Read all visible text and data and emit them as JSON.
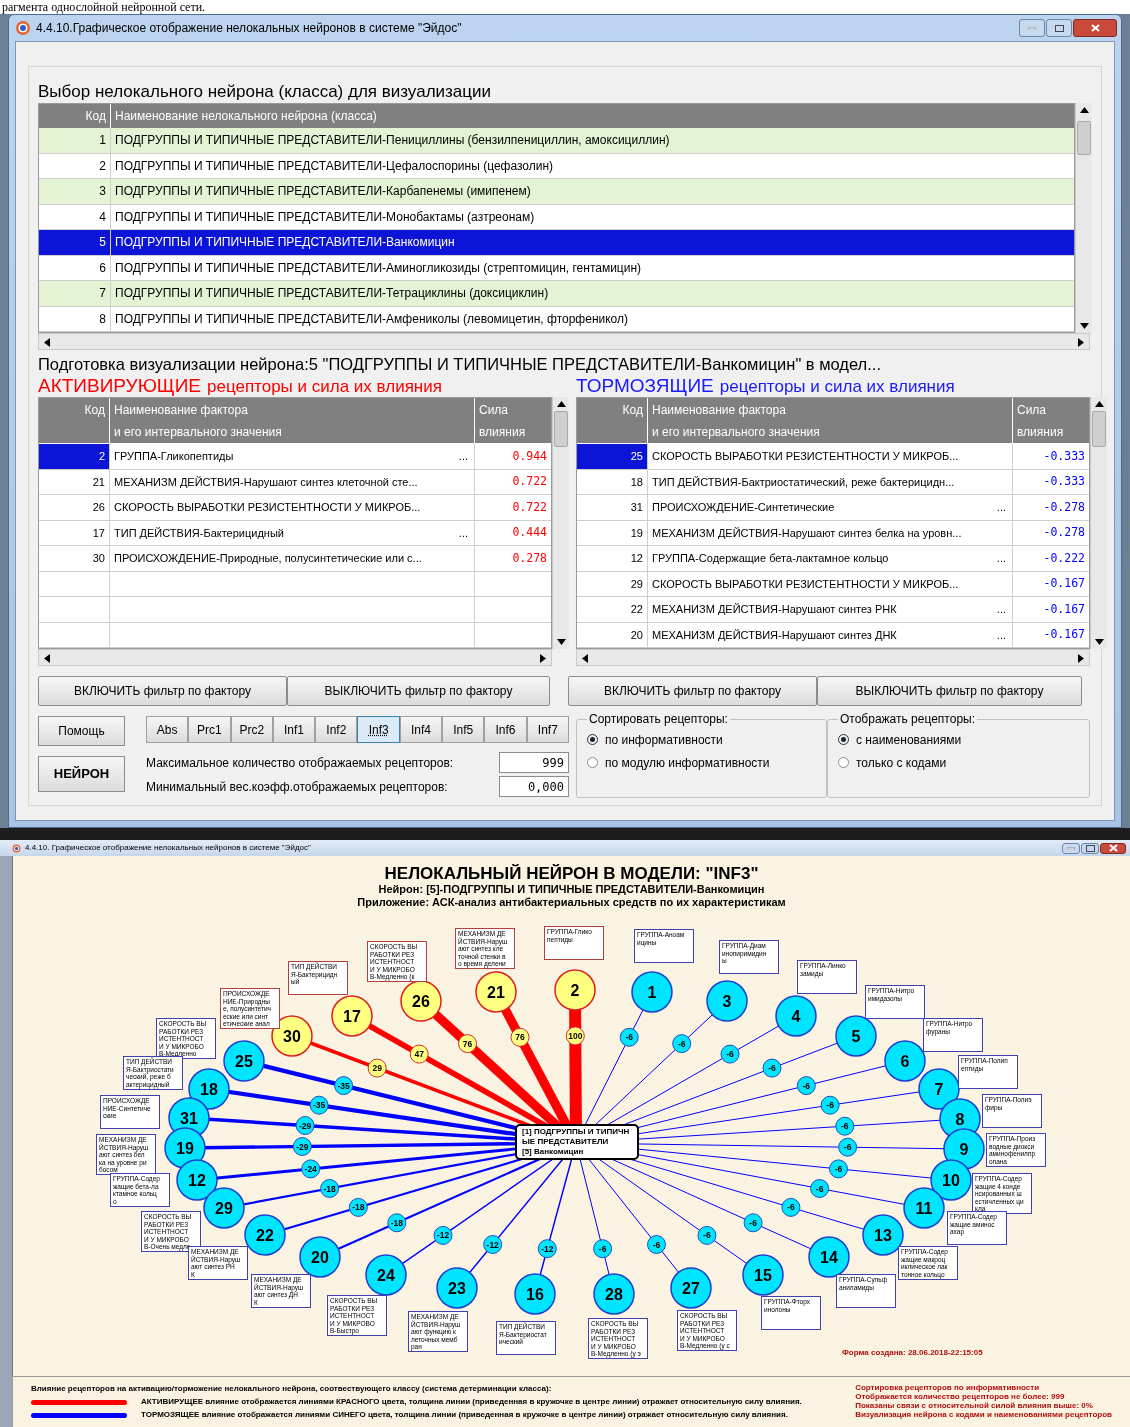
{
  "document_fragment": "рагмента однослойной нейронной сети.",
  "window": {
    "title": "4.4.10.Графическое отображение нелокальных нейронов в системе \"Эйдос\""
  },
  "class_picker": {
    "heading": "Выбор нелокального нейрона (класса) для визуализации",
    "columns": [
      "Код",
      "Наименование нелокального нейрона (класса)"
    ],
    "rows": [
      {
        "code": "1",
        "name": "ПОДГРУППЫ И ТИПИЧНЫЕ ПРЕДСТАВИТЕЛИ-Пенициллины (бензилпенициллин, амоксициллин)",
        "selected": false
      },
      {
        "code": "2",
        "name": "ПОДГРУППЫ И ТИПИЧНЫЕ ПРЕДСТАВИТЕЛИ-Цефалоспорины (цефазолин)",
        "selected": false
      },
      {
        "code": "3",
        "name": "ПОДГРУППЫ И ТИПИЧНЫЕ ПРЕДСТАВИТЕЛИ-Карбапенемы (имипенем)",
        "selected": false
      },
      {
        "code": "4",
        "name": "ПОДГРУППЫ И ТИПИЧНЫЕ ПРЕДСТАВИТЕЛИ-Монобактамы (азтреонам)",
        "selected": false
      },
      {
        "code": "5",
        "name": "ПОДГРУППЫ И ТИПИЧНЫЕ ПРЕДСТАВИТЕЛИ-Ванкомицин",
        "selected": true
      },
      {
        "code": "6",
        "name": "ПОДГРУППЫ И ТИПИЧНЫЕ ПРЕДСТАВИТЕЛИ-Аминогликозиды (стрептомицин, гентамицин)",
        "selected": false
      },
      {
        "code": "7",
        "name": "ПОДГРУППЫ И ТИПИЧНЫЕ ПРЕДСТАВИТЕЛИ-Тетрациклины (доксициклин)",
        "selected": false
      },
      {
        "code": "8",
        "name": "ПОДГРУППЫ И ТИПИЧНЫЕ ПРЕДСТАВИТЕЛИ-Амфениколы (левомицетин, фторфеникол)",
        "selected": false
      }
    ]
  },
  "preparation_heading": "Подготовка визуализации нейрона:5 \"ПОДГРУППЫ И ТИПИЧНЫЕ ПРЕДСТАВИТЕЛИ-Ванкомицин\" в модел...",
  "activating": {
    "title_emphasis": "АКТИВИРУЮЩИЕ",
    "title_rest": "рецепторы и сила их влияния",
    "columns": [
      {
        "lines": [
          "Код"
        ]
      },
      {
        "lines": [
          "Наименование фактора",
          "и его интервального значения"
        ]
      },
      {
        "lines": [
          "Сила",
          "влияния"
        ]
      }
    ],
    "rows": [
      {
        "code": "2",
        "name": "ГРУППА-Гликопептиды",
        "more": "...",
        "strength": "0.944",
        "selected": true
      },
      {
        "code": "21",
        "name": "МЕХАНИЗМ ДЕЙСТВИЯ-Нарушают синтез клеточной сте...",
        "strength": "0.722",
        "selected": false
      },
      {
        "code": "26",
        "name": "СКОРОСТЬ ВЫРАБОТКИ РЕЗИСТЕНТНОСТИ У МИКРОБ...",
        "strength": "0.722",
        "selected": false
      },
      {
        "code": "17",
        "name": "ТИП ДЕЙСТВИЯ-Бактерицидный",
        "more": "...",
        "strength": "0.444",
        "selected": false
      },
      {
        "code": "30",
        "name": "ПРОИСХОЖДЕНИЕ-Природные, полусинтетические или с...",
        "strength": "0.278",
        "selected": false
      }
    ]
  },
  "inhibiting": {
    "title_emphasis": "ТОРМОЗЯЩИЕ",
    "title_rest": "рецепторы и сила их влияния",
    "columns": [
      {
        "lines": [
          "Код"
        ]
      },
      {
        "lines": [
          "Наименование фактора",
          "и его интервального значения"
        ]
      },
      {
        "lines": [
          "Сила",
          "влияния"
        ]
      }
    ],
    "rows": [
      {
        "code": "25",
        "name": "СКОРОСТЬ ВЫРАБОТКИ РЕЗИСТЕНТНОСТИ У МИКРОБ...",
        "strength": "-0.333",
        "selected": true
      },
      {
        "code": "18",
        "name": "ТИП ДЕЙСТВИЯ-Бактриостатический, реже бактерицидн...",
        "strength": "-0.333",
        "selected": false
      },
      {
        "code": "31",
        "name": "ПРОИСХОЖДЕНИЕ-Синтетические",
        "more": "...",
        "strength": "-0.278",
        "selected": false
      },
      {
        "code": "19",
        "name": "МЕХАНИЗМ ДЕЙСТВИЯ-Нарушают синтез белка на уровн...",
        "strength": "-0.278",
        "selected": false
      },
      {
        "code": "12",
        "name": "ГРУППА-Содержащие бета-лактамное кольцо",
        "more": "...",
        "strength": "-0.222",
        "selected": false
      },
      {
        "code": "29",
        "name": "СКОРОСТЬ ВЫРАБОТКИ РЕЗИСТЕНТНОСТИ У МИКРОБ...",
        "strength": "-0.167",
        "selected": false
      },
      {
        "code": "22",
        "name": "МЕХАНИЗМ ДЕЙСТВИЯ-Нарушают синтез РНК",
        "more": "...",
        "strength": "-0.167",
        "selected": false
      },
      {
        "code": "20",
        "name": "МЕХАНИЗМ ДЕЙСТВИЯ-Нарушают синтез ДНК",
        "more": "...",
        "strength": "-0.167",
        "selected": false
      }
    ]
  },
  "filter_buttons_left": [
    "ВКЛЮЧИТЬ фильтр по фактору",
    "ВЫКЛЮЧИТЬ фильтр по фактору"
  ],
  "filter_buttons_right": [
    "ВКЛЮЧИТЬ фильтр по фактору",
    "ВЫКЛЮЧИТЬ фильтр по фактору"
  ],
  "help_button": "Помощь",
  "neuron_button": "НЕЙРОН",
  "model_buttons": [
    {
      "label": "Abs",
      "selected": false
    },
    {
      "label": "Prc1",
      "selected": false
    },
    {
      "label": "Prc2",
      "selected": false
    },
    {
      "label": "Inf1",
      "selected": false
    },
    {
      "label": "Inf2",
      "selected": false
    },
    {
      "label": "Inf3",
      "selected": true
    },
    {
      "label": "Inf4",
      "selected": false
    },
    {
      "label": "Inf5",
      "selected": false
    },
    {
      "label": "Inf6",
      "selected": false
    },
    {
      "label": "Inf7",
      "selected": false
    }
  ],
  "max_receptors": {
    "label": "Максимальное количество отображаемых рецепторов:",
    "value": "999"
  },
  "min_weight": {
    "label": "Минимальный вес.коэфф.отображаемых рецепторов:",
    "value": "0,000"
  },
  "sort_group": {
    "title": "Сортировать рецепторы:",
    "options": [
      {
        "label": "по информативности",
        "selected": true
      },
      {
        "label": "по модулю информативности",
        "selected": false
      }
    ]
  },
  "display_group": {
    "title": "Отображать рецепторы:",
    "options": [
      {
        "label": "с наименованиями",
        "selected": true
      },
      {
        "label": "только с кодами",
        "selected": false
      }
    ]
  },
  "diagram_window": {
    "title": "4.4.10. Графическое отображение нелокальных нейронов в системе \"Эйдос\"",
    "heading": "НЕЛОКАЛЬНЫЙ НЕЙРОН В МОДЕЛИ: \"INF3\"",
    "neuron_line": "Нейрон: [5]-ПОДГРУППЫ И ТИПИЧНЫЕ ПРЕДСТАВИТЕЛИ-Ванкомицин",
    "application_line": "Приложение: АСК-анализ антибактериальных средств по их характеристикам",
    "center_box": [
      "[1] ПОДГРУППЫ И ТИПИЧН",
      "ЫЕ ПРЕДСТАВИТЕЛИ",
      "[5] Ванкомицин"
    ],
    "nodes": [
      {
        "code": "21",
        "kind": "activating",
        "weight": "76",
        "label": [
          "МЕХАНИЗМ ДЕ",
          "ЙСТВИЯ-Наруш",
          "ают синтез кле",
          "точной стенки в",
          "о время делени"
        ]
      },
      {
        "code": "2",
        "kind": "activating",
        "weight": "100",
        "label": [
          "ГРУППА-Глико",
          "пептиды"
        ]
      },
      {
        "code": "1",
        "kind": "inhibiting",
        "weight": "-6",
        "label": [
          "ГРУППА-Аноам",
          "ицины"
        ]
      },
      {
        "code": "26",
        "kind": "activating",
        "weight": "76",
        "label": [
          "СКОРОСТЬ ВЫ",
          "РАБОТКИ РЕЗ",
          "ИСТЕНТНОСТ",
          "И У МИКРОБО",
          "В-Медленно (к"
        ]
      },
      {
        "code": "3",
        "kind": "inhibiting",
        "weight": "-6",
        "label": [
          "ГРУППА-Диам",
          "инопиримидин",
          "ы"
        ]
      },
      {
        "code": "17",
        "kind": "activating",
        "weight": "47",
        "label": [
          "ТИП ДЕЙСТВИ",
          "Я-Бактерицидн",
          "ый"
        ]
      },
      {
        "code": "4",
        "kind": "inhibiting",
        "weight": "-6",
        "label": [
          "ГРУППА-Линко",
          "замиды"
        ]
      },
      {
        "code": "30",
        "kind": "activating",
        "weight": "29",
        "label": [
          "ПРОИСХОЖДЕ",
          "НИЕ-Природны",
          "е, полусинтетич",
          "еские или синт",
          "етические анал"
        ]
      },
      {
        "code": "5",
        "kind": "inhibiting",
        "weight": "-6",
        "label": [
          "ГРУППА-Нитро",
          "имидазолы"
        ]
      },
      {
        "code": "25",
        "kind": "inhibiting",
        "weight": "-35",
        "label": [
          "СКОРОСТЬ ВЫ",
          "РАБОТКИ РЕЗ",
          "ИСТЕНТНОСТ",
          "И У МИКРОБО",
          "В-Медленно"
        ]
      },
      {
        "code": "6",
        "kind": "inhibiting",
        "weight": "-6",
        "label": [
          "ГРУППА-Нитро",
          "фураны"
        ]
      },
      {
        "code": "18",
        "kind": "inhibiting",
        "weight": "-35",
        "label": [
          "ТИП ДЕЙСТВИ",
          "Я-Бактриостати",
          "ческий, реже б",
          "актерицидный"
        ]
      },
      {
        "code": "7",
        "kind": "inhibiting",
        "weight": "-6",
        "label": [
          "ГРУППА-Полип",
          "ептиды"
        ]
      },
      {
        "code": "31",
        "kind": "inhibiting",
        "weight": "-29",
        "label": [
          "ПРОИСХОЖДЕ",
          "НИЕ-Синтетиче",
          "ские"
        ]
      },
      {
        "code": "8",
        "kind": "inhibiting",
        "weight": "-6",
        "label": [
          "ГРУППА-Полиэ",
          "фиры"
        ]
      },
      {
        "code": "19",
        "kind": "inhibiting",
        "weight": "-29",
        "label": [
          "МЕХАНИЗМ ДЕ",
          "ЙСТВИЯ-Наруш",
          "ают синтез бел",
          "ка на уровне ри",
          "босом"
        ]
      },
      {
        "code": "9",
        "kind": "inhibiting",
        "weight": "-6",
        "label": [
          "ГРУППА-Произ",
          "водные диокси",
          "аминофенилпр",
          "опана"
        ]
      },
      {
        "code": "12",
        "kind": "inhibiting",
        "weight": "-24",
        "label": [
          "ГРУППА-Содер",
          "жащие бета-ла",
          "ктамное кольц",
          "о"
        ]
      },
      {
        "code": "10",
        "kind": "inhibiting",
        "weight": "-6",
        "label": [
          "ГРУППА-Содер",
          "жащие 4 конде",
          "нсированных ш",
          "естичленных ци",
          "кла"
        ]
      },
      {
        "code": "29",
        "kind": "inhibiting",
        "weight": "-18",
        "label": [
          "СКОРОСТЬ ВЫ",
          "РАБОТКИ РЕЗ",
          "ИСТЕНТНОСТ",
          "И У МИКРОБО",
          "В-Очень медле"
        ]
      },
      {
        "code": "11",
        "kind": "inhibiting",
        "weight": "-6",
        "label": [
          "ГРУППА-Содер",
          "жащие аминос",
          "ахар"
        ]
      },
      {
        "code": "22",
        "kind": "inhibiting",
        "weight": "-18",
        "label": [
          "МЕХАНИЗМ ДЕ",
          "ЙСТВИЯ-Наруш",
          "ают синтез РН",
          "К"
        ]
      },
      {
        "code": "13",
        "kind": "inhibiting",
        "weight": "-6",
        "label": [
          "ГРУППА-Содер",
          "жащие макроц",
          "иклическое лак",
          "тонное кольцо"
        ]
      },
      {
        "code": "20",
        "kind": "inhibiting",
        "weight": "-18",
        "label": [
          "МЕХАНИЗМ ДЕ",
          "ЙСТВИЯ-Наруш",
          "ают синтез ДН",
          "К"
        ]
      },
      {
        "code": "14",
        "kind": "inhibiting",
        "weight": "-6",
        "label": [
          "ГРУППА-Сульф",
          "аниламиды"
        ]
      },
      {
        "code": "24",
        "kind": "inhibiting",
        "weight": "-12",
        "label": [
          "СКОРОСТЬ ВЫ",
          "РАБОТКИ РЕЗ",
          "ИСТЕНТНОСТ",
          "И У МИКРОВО",
          "В-Быстро"
        ]
      },
      {
        "code": "15",
        "kind": "inhibiting",
        "weight": "-6",
        "label": [
          "ГРУППА-Фторх",
          "инолоны"
        ]
      },
      {
        "code": "23",
        "kind": "inhibiting",
        "weight": "-12",
        "label": [
          "МЕХАНИЗМ ДЕ",
          "ЙСТВИЯ-Наруш",
          "ают функцию к",
          "леточных мемб",
          "ран"
        ]
      },
      {
        "code": "16",
        "kind": "inhibiting",
        "weight": "-12",
        "label": [
          "ТИП ДЕЙСТВИ",
          "Я-Бактериостат",
          "ический"
        ]
      },
      {
        "code": "28",
        "kind": "inhibiting",
        "weight": "-6",
        "label": [
          "СКОРОСТЬ ВЫ",
          "РАБОТКИ РЕЗ",
          "ИСТЕНТНОСТ",
          "И У МИКРОБО",
          "В-Медленно (у э"
        ]
      },
      {
        "code": "27",
        "kind": "inhibiting",
        "weight": "-6",
        "label": [
          "СКОРОСТЬ ВЫ",
          "РАБОТКИ РЕЗ",
          "ИСТЕНТНОСТ",
          "И У МИКРОБО",
          "В-Медленно (у с"
        ]
      }
    ],
    "created": "Форма создана: 28.06.2018-22:15:05",
    "legend": {
      "heading": "Влияние рецепторов на активацию/торможение нелокального нейрона, соотвествующего классу (система детерминации класса):",
      "items": [
        {
          "kind": "activating",
          "text": "АКТИВИРУЩЕЕ влияние отображается линиями КРАСНОГО цвета, толщина линии (приведенная в кружочке в центре линии) отражает относительную силу влияния."
        },
        {
          "kind": "inhibiting",
          "text": "ТОРМОЗЯЩЕЕ влияние отображается линиями СИНЕГО цвета, толщина линии (приведенная в кружочке в центре линии) отражает относительную силу влияния."
        }
      ]
    },
    "summary": [
      "Сортировка рецепторов по информативности",
      "Отображается количество рецепторов не более: 999",
      "Показаны связи с относительной силой влияния выше: 0%",
      "Визуализация нейрона с кодами и наименованиями рецепторов"
    ]
  }
}
